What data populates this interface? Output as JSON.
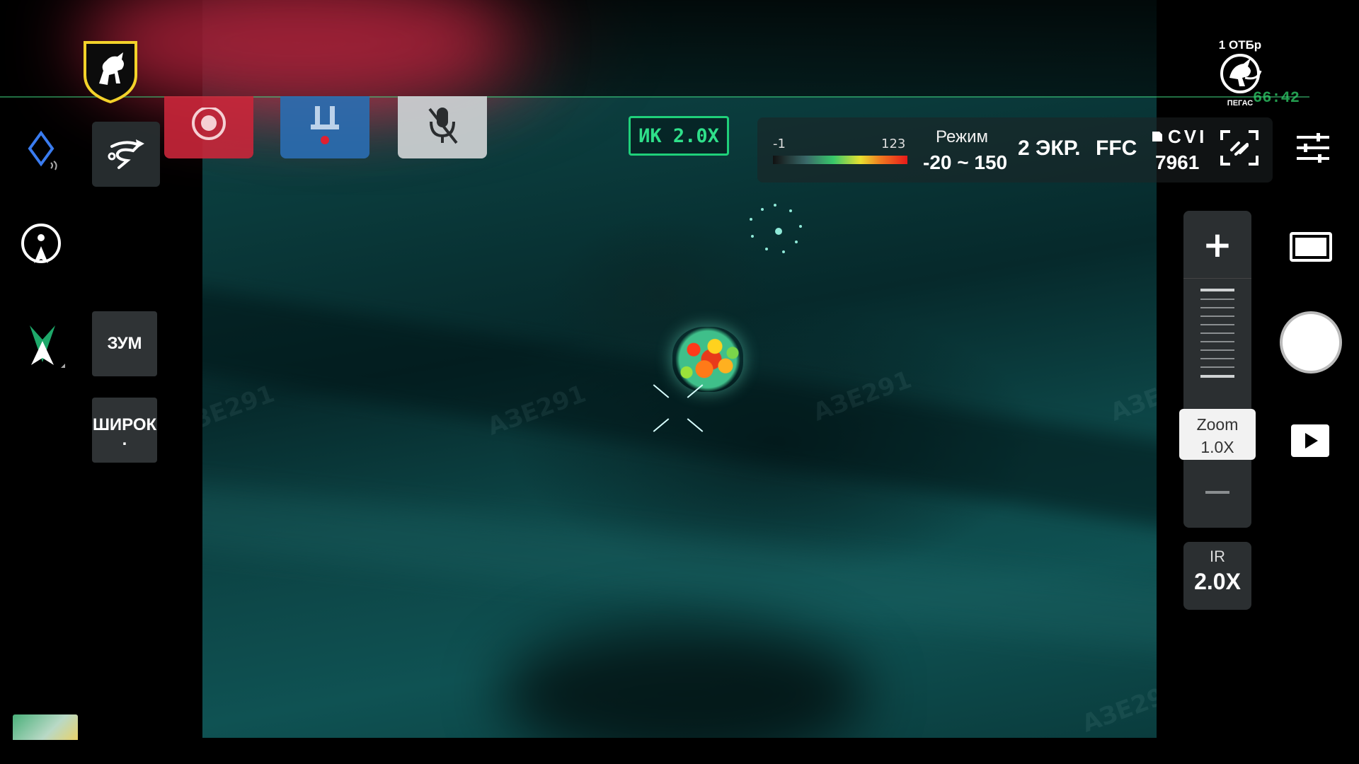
{
  "top_bar": {
    "ir_badge": "ИК 2.0X",
    "scale_min": "-1",
    "scale_max": "123",
    "mode_label": "Режим",
    "mode_range": "-20 ~ 150",
    "screens": "2 ЭКР.",
    "ffc": "FFC",
    "cvi_label": "CVI",
    "cvi_number": "7961"
  },
  "unit_logo": {
    "title": "1 ОТБр",
    "subtitle": "ПЕГАС"
  },
  "timer": "66:42",
  "left_bar": {
    "zoom_button": "ЗУМ",
    "wide_button": "ШИРОК",
    "wide_button_dot": "."
  },
  "right_bar": {
    "zoom_label": "Zoom",
    "zoom_value": "1.0X",
    "ir_label": "IR",
    "ir_value": "2.0X"
  },
  "watermark": "АЗЕ291",
  "icons": {
    "emblem": "horse-shield-emblem",
    "signal": "diamond-signal-icon",
    "route": "route-drone-icon",
    "location": "location-pin-icon",
    "nav": "navigation-arrow-icon",
    "record": "record-icon",
    "payload": "drop-payload-icon",
    "mic": "mic-off-icon",
    "target_lock": "target-lock-icon",
    "settings": "sliders-icon",
    "shutter": "shutter-button",
    "play": "play-icon",
    "frame": "frame-mode-icon"
  },
  "colors": {
    "ir_badge": "#1fd07a",
    "record": "#c9263a",
    "payload": "#2a6cb0",
    "mic": "#c9cdd0",
    "timer": "#2fd06a"
  }
}
